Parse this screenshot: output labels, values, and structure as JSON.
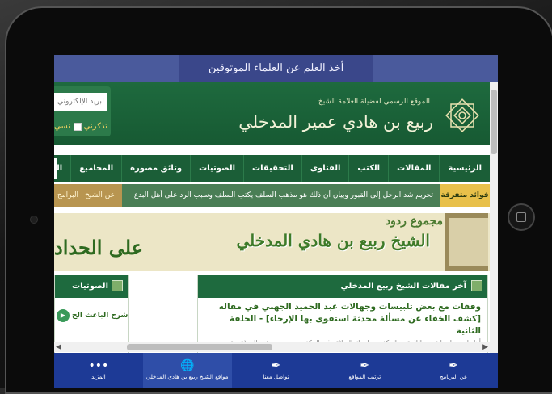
{
  "banner": {
    "text": "أخذ العلم عن العلماء الموثوقين"
  },
  "header": {
    "site_subtitle": "الموقع الرسمي لفضيلة العلامة الشيخ",
    "site_name": "ربيع بن هادي عمير المدخلي",
    "email_placeholder": "البريد الإلكتروني",
    "remember_label": "تذكرني",
    "forgot_label": "نسي"
  },
  "nav": {
    "items": [
      "الرئيسية",
      "المقالات",
      "الكتب",
      "الفتاوى",
      "التحقيقات",
      "الصوتيات",
      "وثائق مصورة",
      "المجاميع",
      "المطويات"
    ]
  },
  "ticker": {
    "label": "فوائد متفرقة",
    "text": "تحريم شد الرحل إلى القبور وبيان أن ذلك هو مذهب السلف    يكتب السلف وسبب الرد على أهل البدع",
    "tabs": [
      "عن الشيخ",
      "البرامج"
    ]
  },
  "hero": {
    "subtitle": "مجموع ردود",
    "title": "الشيخ ربيع بن هادي المدخلي",
    "accent": "على الحداد"
  },
  "articles_panel": {
    "title": "آخر مقالات الشيخ ربيع المدخلي",
    "article_title": "وقفات مع بعض تلبيسات وجهالات عبد الحميد الجهني في مقاله [كشف الخفاء عن مسألة محدثة استقوى بها الإرجاء] - الحلقة الثانية",
    "article_text": "أهل السنة السابقون واللاحقون المكفرون لتارك الصلاة وغير المكفرين يعظمون قدر الصلاة ويقومون"
  },
  "audio_panel": {
    "title": "الصوتيات",
    "item": "شرح الباعث الح"
  },
  "scroll": {
    "left_arrow": "◀",
    "right_arrow": "▶"
  },
  "bottom_tabs": [
    {
      "label": "المزيد",
      "icon": "•••"
    },
    {
      "label": "مواقع الشيخ ربيع بن هادي المدخلي",
      "icon": "🌐"
    },
    {
      "label": "تواصل معنا",
      "icon": "✒"
    },
    {
      "label": "ترتيب المواقع",
      "icon": "✒"
    },
    {
      "label": "عن البرنامج",
      "icon": "✒"
    }
  ],
  "colors": {
    "header_green": "#1e6a3e",
    "banner_blue": "#3a478a",
    "bottom_bar_blue": "#1d3a96",
    "ticker_label_yellow": "#e8c04a"
  }
}
